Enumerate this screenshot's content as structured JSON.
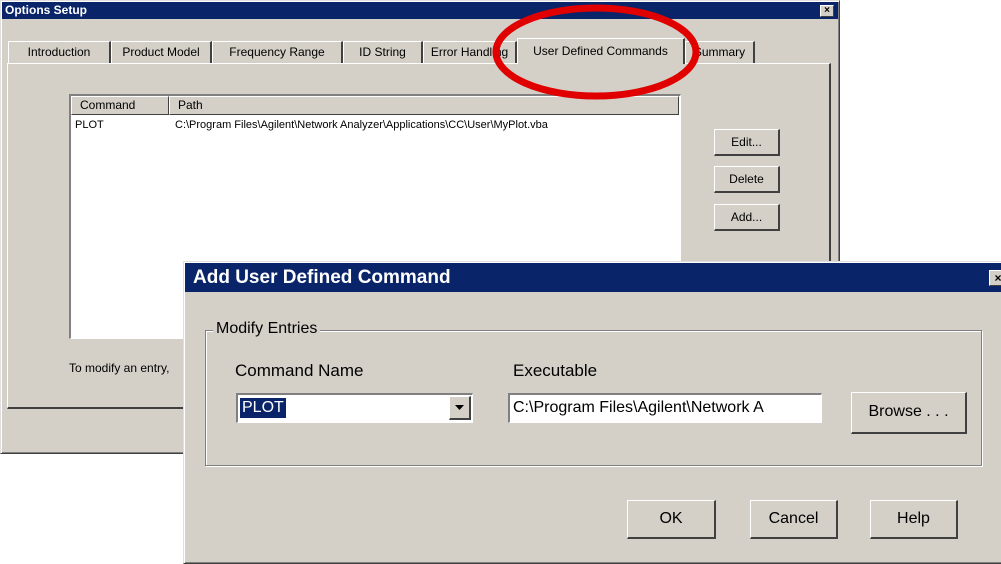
{
  "main_window": {
    "title": "Options Setup",
    "close_glyph": "×",
    "tabs": [
      {
        "label": "Introduction",
        "active": false
      },
      {
        "label": "Product Model",
        "active": false
      },
      {
        "label": "Frequency Range",
        "active": false
      },
      {
        "label": "ID String",
        "active": false
      },
      {
        "label": "Error Handling",
        "active": false
      },
      {
        "label": "User Defined Commands",
        "active": true
      },
      {
        "label": "Summary",
        "active": false
      }
    ],
    "list": {
      "columns": [
        "Command",
        "Path"
      ],
      "rows": [
        {
          "command": "PLOT",
          "path": "C:\\Program Files\\Agilent\\Network Analyzer\\Applications\\CC\\User\\MyPlot.vba"
        }
      ]
    },
    "buttons": {
      "edit": "Edit...",
      "delete": "Delete",
      "add": "Add..."
    },
    "hint": "To modify an entry,"
  },
  "dialog": {
    "title": "Add User Defined Command",
    "close_glyph": "×",
    "group_label": "Modify Entries",
    "command_name_label": "Command Name",
    "command_name_value": "PLOT",
    "executable_label": "Executable",
    "executable_value": "C:\\Program Files\\Agilent\\Network A",
    "browse_label": "Browse . . .",
    "ok_label": "OK",
    "cancel_label": "Cancel",
    "help_label": "Help"
  },
  "colors": {
    "titlebar": "#0a246a",
    "window_face": "#d4d0c8",
    "highlight_circle": "#e00000"
  }
}
